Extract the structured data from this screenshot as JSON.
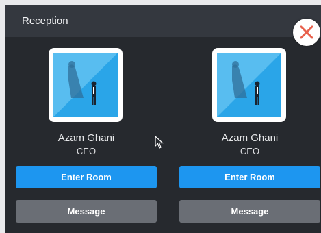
{
  "header": {
    "title": "Reception"
  },
  "colors": {
    "accent": "#1d96f0",
    "panel": "#26292e",
    "secondary_button": "#6a6e75"
  },
  "icons": {
    "close": "close-icon",
    "cursor": "mouse-cursor-icon"
  },
  "cards": [
    {
      "name": "Azam Ghani",
      "role": "CEO",
      "enter_label": "Enter Room",
      "message_label": "Message"
    },
    {
      "name": "Azam Ghani",
      "role": "CEO",
      "enter_label": "Enter Room",
      "message_label": "Message"
    }
  ]
}
